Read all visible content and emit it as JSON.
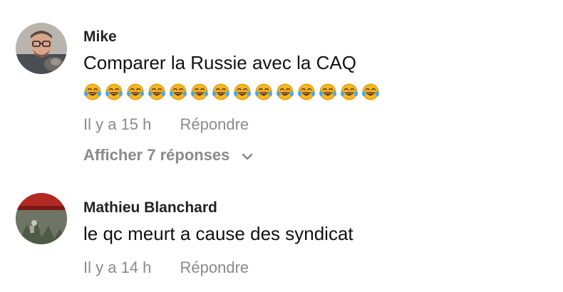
{
  "comments": [
    {
      "author": "Mike",
      "text": "Comparer la Russie avec la CAQ",
      "emoji": "😂😂😂😂😂😂😂😂😂😂😂😂😂😂",
      "time": "Il y a 15 h",
      "reply_label": "Répondre",
      "view_replies": "Afficher 7 réponses"
    },
    {
      "author": "Mathieu Blanchard",
      "text": "le qc meurt a cause des syndicat",
      "time": "Il y a 14 h",
      "reply_label": "Répondre"
    }
  ],
  "icons": {
    "emoji": "face-with-tears-of-joy",
    "expand": "chevron-down-icon"
  },
  "colors": {
    "meta_text": "#8a8a8a",
    "emoji_face": "#f5b521"
  }
}
